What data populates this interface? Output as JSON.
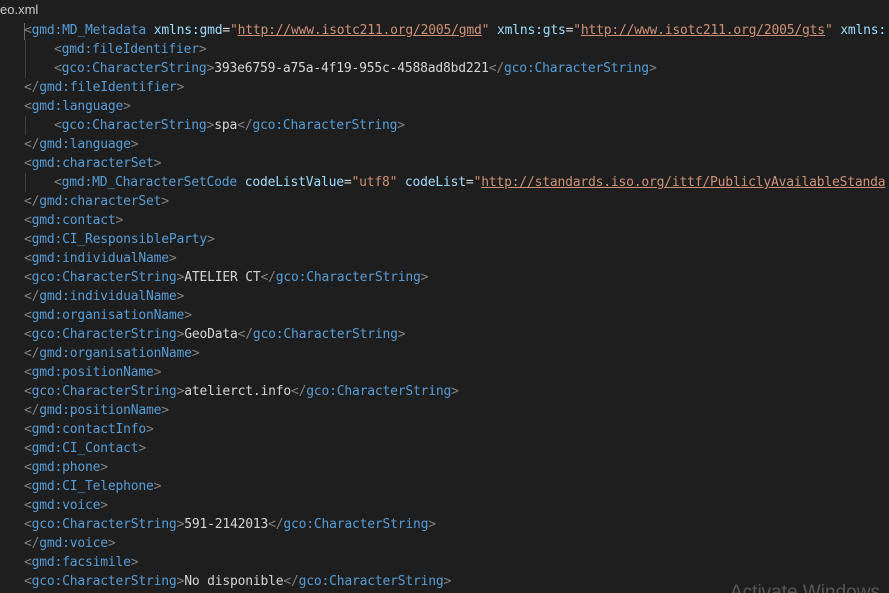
{
  "tab": {
    "filename": "eo.xml"
  },
  "colors": {
    "background": "#1e1e1e",
    "tag": "#569cd6",
    "bracket": "#808080",
    "attribute": "#9cdcfe",
    "string": "#ce9178",
    "text": "#d4d4d4"
  },
  "watermark": "Activate Windows",
  "lines": [
    {
      "indent": 0,
      "tokens": [
        {
          "t": "bracket",
          "v": "<"
        },
        {
          "t": "tag",
          "v": "gmd:MD_Metadata"
        },
        {
          "t": "text",
          "v": " "
        },
        {
          "t": "attr",
          "v": "xmlns:gmd"
        },
        {
          "t": "eq",
          "v": "="
        },
        {
          "t": "str",
          "v": "\""
        },
        {
          "t": "link",
          "v": "http://www.isotc211.org/2005/gmd"
        },
        {
          "t": "str",
          "v": "\""
        },
        {
          "t": "text",
          "v": " "
        },
        {
          "t": "attr",
          "v": "xmlns:gts"
        },
        {
          "t": "eq",
          "v": "="
        },
        {
          "t": "str",
          "v": "\""
        },
        {
          "t": "link",
          "v": "http://www.isotc211.org/2005/gts"
        },
        {
          "t": "str",
          "v": "\""
        },
        {
          "t": "text",
          "v": " "
        },
        {
          "t": "attr",
          "v": "xmlns:"
        }
      ]
    },
    {
      "indent": 1,
      "tokens": [
        {
          "t": "bracket",
          "v": "<"
        },
        {
          "t": "tag",
          "v": "gmd:fileIdentifier"
        },
        {
          "t": "bracket",
          "v": ">"
        }
      ]
    },
    {
      "indent": 1,
      "tokens": [
        {
          "t": "bracket",
          "v": "<"
        },
        {
          "t": "tag",
          "v": "gco:CharacterString"
        },
        {
          "t": "bracket",
          "v": ">"
        },
        {
          "t": "text",
          "v": "393e6759-a75a-4f19-955c-4588ad8bd221"
        },
        {
          "t": "bracket",
          "v": "</"
        },
        {
          "t": "tag",
          "v": "gco:CharacterString"
        },
        {
          "t": "bracket",
          "v": ">"
        }
      ]
    },
    {
      "indent": 0,
      "tokens": [
        {
          "t": "bracket",
          "v": "</"
        },
        {
          "t": "tag",
          "v": "gmd:fileIdentifier"
        },
        {
          "t": "bracket",
          "v": ">"
        }
      ]
    },
    {
      "indent": 0,
      "tokens": [
        {
          "t": "bracket",
          "v": "<"
        },
        {
          "t": "tag",
          "v": "gmd:language"
        },
        {
          "t": "bracket",
          "v": ">"
        }
      ]
    },
    {
      "indent": 1,
      "tokens": [
        {
          "t": "bracket",
          "v": "<"
        },
        {
          "t": "tag",
          "v": "gco:CharacterString"
        },
        {
          "t": "bracket",
          "v": ">"
        },
        {
          "t": "text",
          "v": "spa"
        },
        {
          "t": "bracket",
          "v": "</"
        },
        {
          "t": "tag",
          "v": "gco:CharacterString"
        },
        {
          "t": "bracket",
          "v": ">"
        }
      ]
    },
    {
      "indent": 0,
      "tokens": [
        {
          "t": "bracket",
          "v": "</"
        },
        {
          "t": "tag",
          "v": "gmd:language"
        },
        {
          "t": "bracket",
          "v": ">"
        }
      ]
    },
    {
      "indent": 0,
      "tokens": [
        {
          "t": "bracket",
          "v": "<"
        },
        {
          "t": "tag",
          "v": "gmd:characterSet"
        },
        {
          "t": "bracket",
          "v": ">"
        }
      ]
    },
    {
      "indent": 1,
      "tokens": [
        {
          "t": "bracket",
          "v": "<"
        },
        {
          "t": "tag",
          "v": "gmd:MD_CharacterSetCode"
        },
        {
          "t": "text",
          "v": " "
        },
        {
          "t": "attr",
          "v": "codeListValue"
        },
        {
          "t": "eq",
          "v": "="
        },
        {
          "t": "str",
          "v": "\"utf8\""
        },
        {
          "t": "text",
          "v": " "
        },
        {
          "t": "attr",
          "v": "codeList"
        },
        {
          "t": "eq",
          "v": "="
        },
        {
          "t": "str",
          "v": "\""
        },
        {
          "t": "link",
          "v": "http://standards.iso.org/ittf/PubliclyAvailableStanda"
        }
      ]
    },
    {
      "indent": 0,
      "tokens": [
        {
          "t": "bracket",
          "v": "</"
        },
        {
          "t": "tag",
          "v": "gmd:characterSet"
        },
        {
          "t": "bracket",
          "v": ">"
        }
      ]
    },
    {
      "indent": 0,
      "tokens": [
        {
          "t": "bracket",
          "v": "<"
        },
        {
          "t": "tag",
          "v": "gmd:contact"
        },
        {
          "t": "bracket",
          "v": ">"
        }
      ]
    },
    {
      "indent": 0,
      "tokens": [
        {
          "t": "bracket",
          "v": "<"
        },
        {
          "t": "tag",
          "v": "gmd:CI_ResponsibleParty"
        },
        {
          "t": "bracket",
          "v": ">"
        }
      ]
    },
    {
      "indent": 0,
      "tokens": [
        {
          "t": "bracket",
          "v": "<"
        },
        {
          "t": "tag",
          "v": "gmd:individualName"
        },
        {
          "t": "bracket",
          "v": ">"
        }
      ]
    },
    {
      "indent": 0,
      "tokens": [
        {
          "t": "bracket",
          "v": "<"
        },
        {
          "t": "tag",
          "v": "gco:CharacterString"
        },
        {
          "t": "bracket",
          "v": ">"
        },
        {
          "t": "text",
          "v": "ATELIER CT"
        },
        {
          "t": "bracket",
          "v": "</"
        },
        {
          "t": "tag",
          "v": "gco:CharacterString"
        },
        {
          "t": "bracket",
          "v": ">"
        }
      ]
    },
    {
      "indent": 0,
      "tokens": [
        {
          "t": "bracket",
          "v": "</"
        },
        {
          "t": "tag",
          "v": "gmd:individualName"
        },
        {
          "t": "bracket",
          "v": ">"
        }
      ]
    },
    {
      "indent": 0,
      "tokens": [
        {
          "t": "bracket",
          "v": "<"
        },
        {
          "t": "tag",
          "v": "gmd:organisationName"
        },
        {
          "t": "bracket",
          "v": ">"
        }
      ]
    },
    {
      "indent": 0,
      "tokens": [
        {
          "t": "bracket",
          "v": "<"
        },
        {
          "t": "tag",
          "v": "gco:CharacterString"
        },
        {
          "t": "bracket",
          "v": ">"
        },
        {
          "t": "text",
          "v": "GeoData"
        },
        {
          "t": "bracket",
          "v": "</"
        },
        {
          "t": "tag",
          "v": "gco:CharacterString"
        },
        {
          "t": "bracket",
          "v": ">"
        }
      ]
    },
    {
      "indent": 0,
      "tokens": [
        {
          "t": "bracket",
          "v": "</"
        },
        {
          "t": "tag",
          "v": "gmd:organisationName"
        },
        {
          "t": "bracket",
          "v": ">"
        }
      ]
    },
    {
      "indent": 0,
      "tokens": [
        {
          "t": "bracket",
          "v": "<"
        },
        {
          "t": "tag",
          "v": "gmd:positionName"
        },
        {
          "t": "bracket",
          "v": ">"
        }
      ]
    },
    {
      "indent": 0,
      "tokens": [
        {
          "t": "bracket",
          "v": "<"
        },
        {
          "t": "tag",
          "v": "gco:CharacterString"
        },
        {
          "t": "bracket",
          "v": ">"
        },
        {
          "t": "text",
          "v": "atelierct.info"
        },
        {
          "t": "bracket",
          "v": "</"
        },
        {
          "t": "tag",
          "v": "gco:CharacterString"
        },
        {
          "t": "bracket",
          "v": ">"
        }
      ]
    },
    {
      "indent": 0,
      "tokens": [
        {
          "t": "bracket",
          "v": "</"
        },
        {
          "t": "tag",
          "v": "gmd:positionName"
        },
        {
          "t": "bracket",
          "v": ">"
        }
      ]
    },
    {
      "indent": 0,
      "tokens": [
        {
          "t": "bracket",
          "v": "<"
        },
        {
          "t": "tag",
          "v": "gmd:contactInfo"
        },
        {
          "t": "bracket",
          "v": ">"
        }
      ]
    },
    {
      "indent": 0,
      "tokens": [
        {
          "t": "bracket",
          "v": "<"
        },
        {
          "t": "tag",
          "v": "gmd:CI_Contact"
        },
        {
          "t": "bracket",
          "v": ">"
        }
      ]
    },
    {
      "indent": 0,
      "tokens": [
        {
          "t": "bracket",
          "v": "<"
        },
        {
          "t": "tag",
          "v": "gmd:phone"
        },
        {
          "t": "bracket",
          "v": ">"
        }
      ]
    },
    {
      "indent": 0,
      "tokens": [
        {
          "t": "bracket",
          "v": "<"
        },
        {
          "t": "tag",
          "v": "gmd:CI_Telephone"
        },
        {
          "t": "bracket",
          "v": ">"
        }
      ]
    },
    {
      "indent": 0,
      "tokens": [
        {
          "t": "bracket",
          "v": "<"
        },
        {
          "t": "tag",
          "v": "gmd:voice"
        },
        {
          "t": "bracket",
          "v": ">"
        }
      ]
    },
    {
      "indent": 0,
      "tokens": [
        {
          "t": "bracket",
          "v": "<"
        },
        {
          "t": "tag",
          "v": "gco:CharacterString"
        },
        {
          "t": "bracket",
          "v": ">"
        },
        {
          "t": "text",
          "v": "591-2142013"
        },
        {
          "t": "bracket",
          "v": "</"
        },
        {
          "t": "tag",
          "v": "gco:CharacterString"
        },
        {
          "t": "bracket",
          "v": ">"
        }
      ]
    },
    {
      "indent": 0,
      "tokens": [
        {
          "t": "bracket",
          "v": "</"
        },
        {
          "t": "tag",
          "v": "gmd:voice"
        },
        {
          "t": "bracket",
          "v": ">"
        }
      ]
    },
    {
      "indent": 0,
      "tokens": [
        {
          "t": "bracket",
          "v": "<"
        },
        {
          "t": "tag",
          "v": "gmd:facsimile"
        },
        {
          "t": "bracket",
          "v": ">"
        }
      ]
    },
    {
      "indent": 0,
      "tokens": [
        {
          "t": "bracket",
          "v": "<"
        },
        {
          "t": "tag",
          "v": "gco:CharacterString"
        },
        {
          "t": "bracket",
          "v": ">"
        },
        {
          "t": "text",
          "v": "No disponible"
        },
        {
          "t": "bracket",
          "v": "</"
        },
        {
          "t": "tag",
          "v": "gco:CharacterString"
        },
        {
          "t": "bracket",
          "v": ">"
        }
      ]
    }
  ]
}
